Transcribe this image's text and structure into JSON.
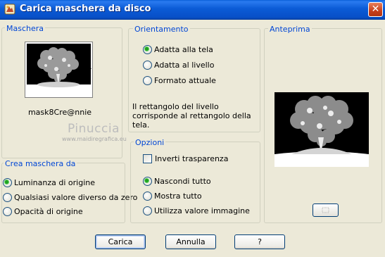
{
  "window": {
    "title": "Carica maschera da disco",
    "icon": "app-icon",
    "close_icon": "close-icon",
    "close_glyph": "✕"
  },
  "mask_group": {
    "legend": "Maschera",
    "selected_mask": "mask8Cre@nnie",
    "thumbnail": "tree-heart-mask",
    "dropdown_icon": "triangle-down-icon"
  },
  "watermark": {
    "name": "Pinuccia",
    "url": "www.maidiregrafica.eu"
  },
  "orientation": {
    "legend": "Orientamento",
    "options": [
      {
        "label": "Adatta alla tela",
        "selected": true
      },
      {
        "label": "Adatta al livello",
        "selected": false
      },
      {
        "label": "Formato attuale",
        "selected": false
      }
    ],
    "description": "Il rettangolo del livello corrisponde al rettangolo della tela."
  },
  "create_mask": {
    "legend": "Crea maschera da",
    "options": [
      {
        "label": "Luminanza di origine",
        "selected": true
      },
      {
        "label": "Qualsiasi valore diverso da zero",
        "selected": false
      },
      {
        "label": "Opacità di origine",
        "selected": false
      }
    ]
  },
  "options": {
    "legend": "Opzioni",
    "invert_label": "Inverti trasparenza",
    "invert_checked": false,
    "options": [
      {
        "label": "Nascondi tutto",
        "selected": true
      },
      {
        "label": "Mostra tutto",
        "selected": false
      },
      {
        "label": "Utilizza valore immagine",
        "selected": false
      }
    ]
  },
  "preview": {
    "legend": "Anteprima",
    "image": "tree-heart-preview"
  },
  "buttons": {
    "load": "Carica",
    "cancel": "Annulla",
    "help": "?"
  },
  "colors": {
    "title_bar": "#0b5bd6",
    "group_label": "#0046d5",
    "radio_selected": "#21a121",
    "dialog_bg": "#ece9d8"
  }
}
